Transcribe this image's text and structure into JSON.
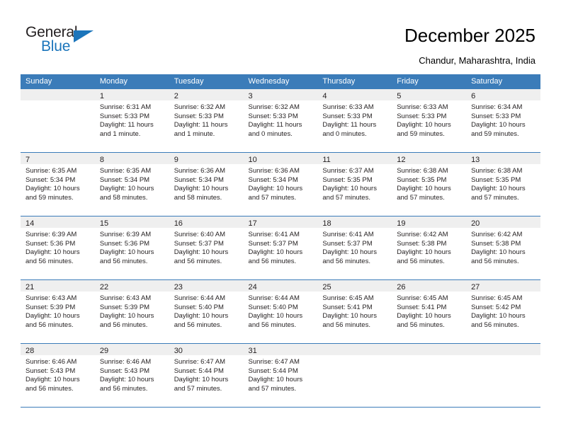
{
  "logo": {
    "word_one": "General",
    "word_two": "Blue",
    "flag_icon": "blue-triangle-flag"
  },
  "header": {
    "title": "December 2025",
    "subtitle": "Chandur, Maharashtra, India"
  },
  "colors": {
    "header_blue": "#3b7cb9",
    "band_gray": "#efefef",
    "logo_blue": "#1b75bb",
    "text": "#231f20"
  },
  "calendar": {
    "day_headers": [
      "Sunday",
      "Monday",
      "Tuesday",
      "Wednesday",
      "Thursday",
      "Friday",
      "Saturday"
    ],
    "weeks": [
      [
        {
          "day": "",
          "sunrise": "",
          "sunset": "",
          "daylight_a": "",
          "daylight_b": ""
        },
        {
          "day": "1",
          "sunrise": "Sunrise: 6:31 AM",
          "sunset": "Sunset: 5:33 PM",
          "daylight_a": "Daylight: 11 hours",
          "daylight_b": "and 1 minute."
        },
        {
          "day": "2",
          "sunrise": "Sunrise: 6:32 AM",
          "sunset": "Sunset: 5:33 PM",
          "daylight_a": "Daylight: 11 hours",
          "daylight_b": "and 1 minute."
        },
        {
          "day": "3",
          "sunrise": "Sunrise: 6:32 AM",
          "sunset": "Sunset: 5:33 PM",
          "daylight_a": "Daylight: 11 hours",
          "daylight_b": "and 0 minutes."
        },
        {
          "day": "4",
          "sunrise": "Sunrise: 6:33 AM",
          "sunset": "Sunset: 5:33 PM",
          "daylight_a": "Daylight: 11 hours",
          "daylight_b": "and 0 minutes."
        },
        {
          "day": "5",
          "sunrise": "Sunrise: 6:33 AM",
          "sunset": "Sunset: 5:33 PM",
          "daylight_a": "Daylight: 10 hours",
          "daylight_b": "and 59 minutes."
        },
        {
          "day": "6",
          "sunrise": "Sunrise: 6:34 AM",
          "sunset": "Sunset: 5:33 PM",
          "daylight_a": "Daylight: 10 hours",
          "daylight_b": "and 59 minutes."
        }
      ],
      [
        {
          "day": "7",
          "sunrise": "Sunrise: 6:35 AM",
          "sunset": "Sunset: 5:34 PM",
          "daylight_a": "Daylight: 10 hours",
          "daylight_b": "and 59 minutes."
        },
        {
          "day": "8",
          "sunrise": "Sunrise: 6:35 AM",
          "sunset": "Sunset: 5:34 PM",
          "daylight_a": "Daylight: 10 hours",
          "daylight_b": "and 58 minutes."
        },
        {
          "day": "9",
          "sunrise": "Sunrise: 6:36 AM",
          "sunset": "Sunset: 5:34 PM",
          "daylight_a": "Daylight: 10 hours",
          "daylight_b": "and 58 minutes."
        },
        {
          "day": "10",
          "sunrise": "Sunrise: 6:36 AM",
          "sunset": "Sunset: 5:34 PM",
          "daylight_a": "Daylight: 10 hours",
          "daylight_b": "and 57 minutes."
        },
        {
          "day": "11",
          "sunrise": "Sunrise: 6:37 AM",
          "sunset": "Sunset: 5:35 PM",
          "daylight_a": "Daylight: 10 hours",
          "daylight_b": "and 57 minutes."
        },
        {
          "day": "12",
          "sunrise": "Sunrise: 6:38 AM",
          "sunset": "Sunset: 5:35 PM",
          "daylight_a": "Daylight: 10 hours",
          "daylight_b": "and 57 minutes."
        },
        {
          "day": "13",
          "sunrise": "Sunrise: 6:38 AM",
          "sunset": "Sunset: 5:35 PM",
          "daylight_a": "Daylight: 10 hours",
          "daylight_b": "and 57 minutes."
        }
      ],
      [
        {
          "day": "14",
          "sunrise": "Sunrise: 6:39 AM",
          "sunset": "Sunset: 5:36 PM",
          "daylight_a": "Daylight: 10 hours",
          "daylight_b": "and 56 minutes."
        },
        {
          "day": "15",
          "sunrise": "Sunrise: 6:39 AM",
          "sunset": "Sunset: 5:36 PM",
          "daylight_a": "Daylight: 10 hours",
          "daylight_b": "and 56 minutes."
        },
        {
          "day": "16",
          "sunrise": "Sunrise: 6:40 AM",
          "sunset": "Sunset: 5:37 PM",
          "daylight_a": "Daylight: 10 hours",
          "daylight_b": "and 56 minutes."
        },
        {
          "day": "17",
          "sunrise": "Sunrise: 6:41 AM",
          "sunset": "Sunset: 5:37 PM",
          "daylight_a": "Daylight: 10 hours",
          "daylight_b": "and 56 minutes."
        },
        {
          "day": "18",
          "sunrise": "Sunrise: 6:41 AM",
          "sunset": "Sunset: 5:37 PM",
          "daylight_a": "Daylight: 10 hours",
          "daylight_b": "and 56 minutes."
        },
        {
          "day": "19",
          "sunrise": "Sunrise: 6:42 AM",
          "sunset": "Sunset: 5:38 PM",
          "daylight_a": "Daylight: 10 hours",
          "daylight_b": "and 56 minutes."
        },
        {
          "day": "20",
          "sunrise": "Sunrise: 6:42 AM",
          "sunset": "Sunset: 5:38 PM",
          "daylight_a": "Daylight: 10 hours",
          "daylight_b": "and 56 minutes."
        }
      ],
      [
        {
          "day": "21",
          "sunrise": "Sunrise: 6:43 AM",
          "sunset": "Sunset: 5:39 PM",
          "daylight_a": "Daylight: 10 hours",
          "daylight_b": "and 56 minutes."
        },
        {
          "day": "22",
          "sunrise": "Sunrise: 6:43 AM",
          "sunset": "Sunset: 5:39 PM",
          "daylight_a": "Daylight: 10 hours",
          "daylight_b": "and 56 minutes."
        },
        {
          "day": "23",
          "sunrise": "Sunrise: 6:44 AM",
          "sunset": "Sunset: 5:40 PM",
          "daylight_a": "Daylight: 10 hours",
          "daylight_b": "and 56 minutes."
        },
        {
          "day": "24",
          "sunrise": "Sunrise: 6:44 AM",
          "sunset": "Sunset: 5:40 PM",
          "daylight_a": "Daylight: 10 hours",
          "daylight_b": "and 56 minutes."
        },
        {
          "day": "25",
          "sunrise": "Sunrise: 6:45 AM",
          "sunset": "Sunset: 5:41 PM",
          "daylight_a": "Daylight: 10 hours",
          "daylight_b": "and 56 minutes."
        },
        {
          "day": "26",
          "sunrise": "Sunrise: 6:45 AM",
          "sunset": "Sunset: 5:41 PM",
          "daylight_a": "Daylight: 10 hours",
          "daylight_b": "and 56 minutes."
        },
        {
          "day": "27",
          "sunrise": "Sunrise: 6:45 AM",
          "sunset": "Sunset: 5:42 PM",
          "daylight_a": "Daylight: 10 hours",
          "daylight_b": "and 56 minutes."
        }
      ],
      [
        {
          "day": "28",
          "sunrise": "Sunrise: 6:46 AM",
          "sunset": "Sunset: 5:43 PM",
          "daylight_a": "Daylight: 10 hours",
          "daylight_b": "and 56 minutes."
        },
        {
          "day": "29",
          "sunrise": "Sunrise: 6:46 AM",
          "sunset": "Sunset: 5:43 PM",
          "daylight_a": "Daylight: 10 hours",
          "daylight_b": "and 56 minutes."
        },
        {
          "day": "30",
          "sunrise": "Sunrise: 6:47 AM",
          "sunset": "Sunset: 5:44 PM",
          "daylight_a": "Daylight: 10 hours",
          "daylight_b": "and 57 minutes."
        },
        {
          "day": "31",
          "sunrise": "Sunrise: 6:47 AM",
          "sunset": "Sunset: 5:44 PM",
          "daylight_a": "Daylight: 10 hours",
          "daylight_b": "and 57 minutes."
        },
        {
          "day": "",
          "sunrise": "",
          "sunset": "",
          "daylight_a": "",
          "daylight_b": ""
        },
        {
          "day": "",
          "sunrise": "",
          "sunset": "",
          "daylight_a": "",
          "daylight_b": ""
        },
        {
          "day": "",
          "sunrise": "",
          "sunset": "",
          "daylight_a": "",
          "daylight_b": ""
        }
      ]
    ]
  }
}
